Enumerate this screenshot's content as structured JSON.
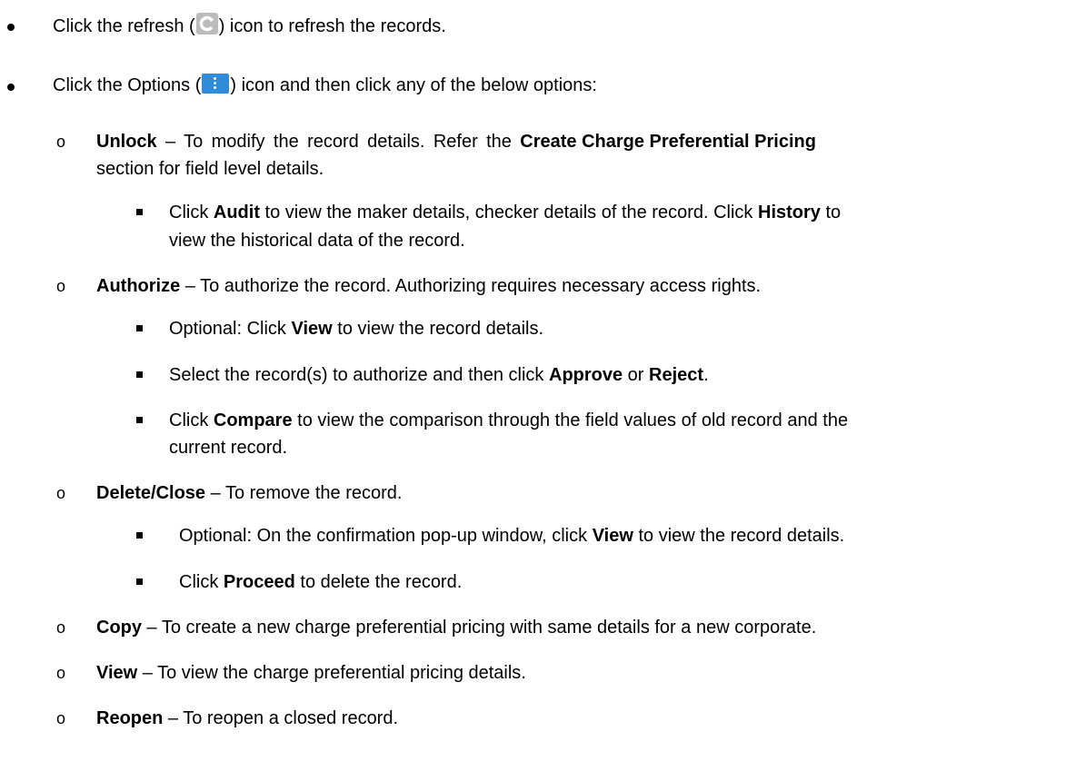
{
  "items": {
    "refresh": {
      "pre": "Click the refresh (",
      "post": ") icon to refresh the records."
    },
    "options": {
      "pre": "Click the Options (",
      "post": ") icon and then click any of the below options:"
    },
    "unlock": {
      "term": "Unlock",
      "t1": " – To modify the record details. Refer the ",
      "ref": "Create Charge Preferential Pricing",
      "t2": "section for field level details.",
      "sub": {
        "a": "Click ",
        "audit": "Audit",
        "b": " to view the maker details, checker details of the record. Click ",
        "history": "History",
        "c": " to",
        "d": "view the historical data of the record."
      }
    },
    "authorize": {
      "term": "Authorize",
      "text": " – To authorize the record. Authorizing requires necessary access rights.",
      "sub1": {
        "a": "Optional: Click ",
        "view": "View",
        "b": " to view the record details."
      },
      "sub2": {
        "a": "Select the record(s) to authorize and then click ",
        "approve": "Approve",
        "b": " or ",
        "reject": "Reject",
        "c": "."
      },
      "sub3": {
        "a": "Click ",
        "compare": "Compare",
        "b": " to view the comparison through the field values of old record and the",
        "c": "current record."
      }
    },
    "delete": {
      "term": "Delete/Close",
      "text": " – To remove the record.",
      "sub1": {
        "a": "Optional: On the confirmation pop-up window, click ",
        "view": "View",
        "b": " to view the record details."
      },
      "sub2": {
        "a": "Click ",
        "proceed": "Proceed",
        "b": " to delete the record."
      }
    },
    "copy": {
      "term": "Copy",
      "text": " – To create a new charge preferential pricing with same details for a new corporate."
    },
    "view": {
      "term": "View",
      "text": " – To view the charge preferential pricing details."
    },
    "reopen": {
      "term": "Reopen",
      "text": " – To reopen a closed record."
    }
  },
  "icons": {
    "refresh": "refresh-icon",
    "options": "options-kebab-icon"
  },
  "colors": {
    "options_icon_bg": "#2e8cd9",
    "refresh_icon_bg": "#bcbcbc"
  }
}
